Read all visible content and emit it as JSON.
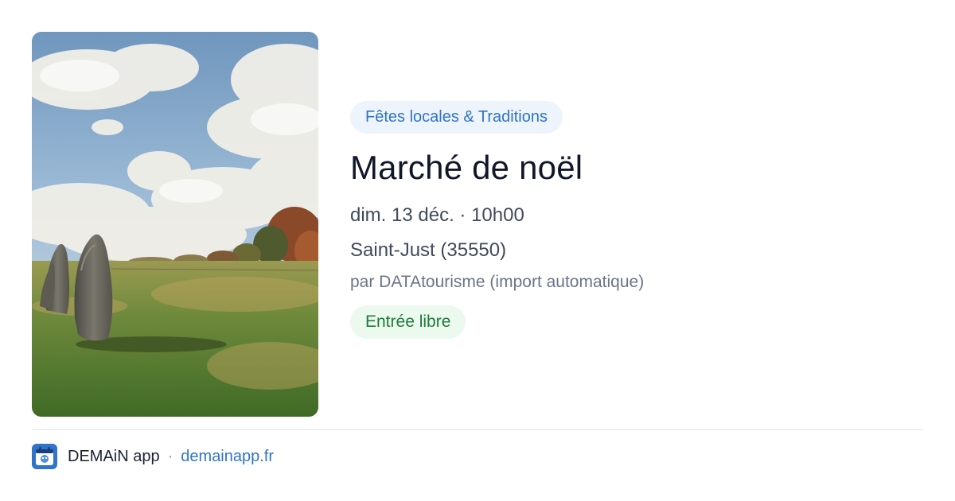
{
  "event": {
    "photo_icon": "standing-stones-photo",
    "category": "Fêtes locales & Traditions",
    "title": "Marché de noël",
    "datetime": "dim. 13 déc. · 10h00",
    "location": "Saint-Just (35550)",
    "organizer": "par DATAtourisme (import automatique)",
    "price": "Entrée libre"
  },
  "footer": {
    "app_icon": "demain-app-icon",
    "app_name": "DEMAiN app",
    "separator": "·",
    "link": "demainapp.fr"
  },
  "colors": {
    "accent": "#2f74c8",
    "category_bg": "#eef4fc",
    "price_text": "#1f7a3a",
    "price_bg": "#ecf9ef",
    "title": "#101828"
  }
}
